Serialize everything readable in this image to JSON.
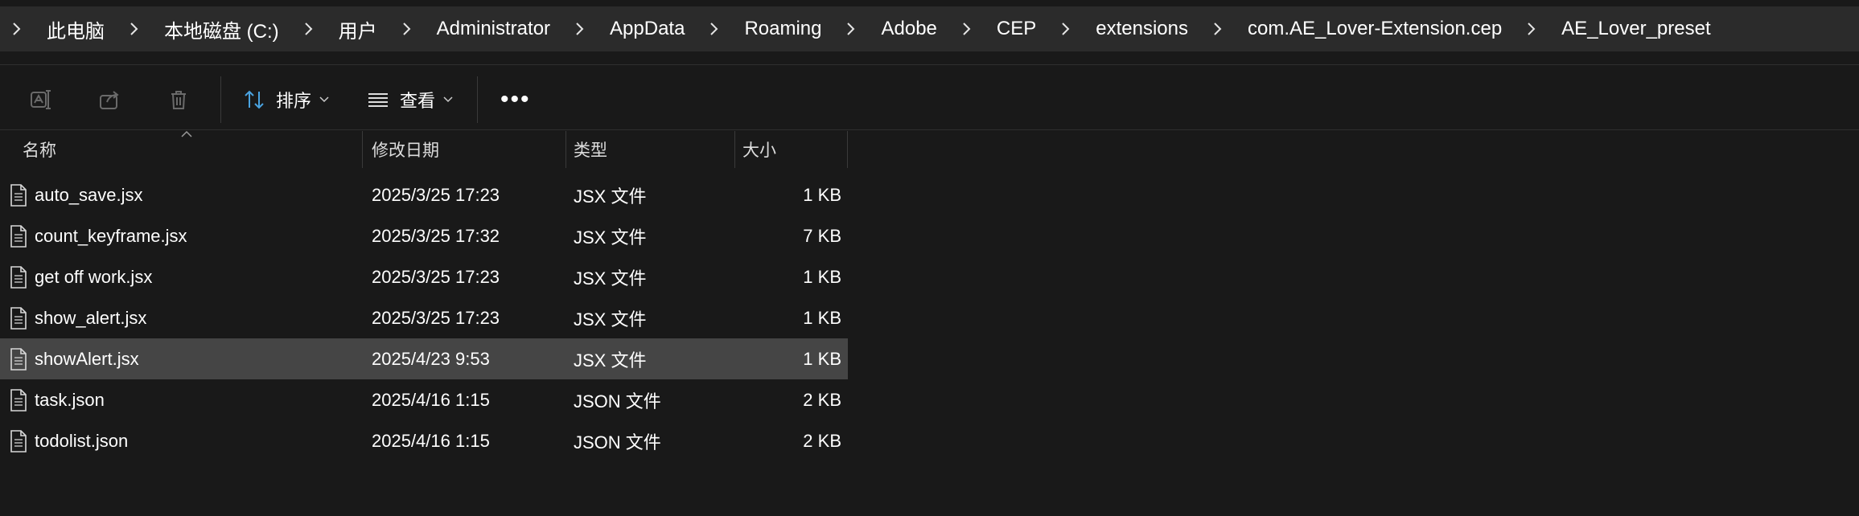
{
  "breadcrumb": [
    "此电脑",
    "本地磁盘 (C:)",
    "用户",
    "Administrator",
    "AppData",
    "Roaming",
    "Adobe",
    "CEP",
    "extensions",
    "com.AE_Lover-Extension.cep",
    "AE_Lover_preset"
  ],
  "toolbar": {
    "rename_icon": "rename-icon",
    "share_icon": "share-icon",
    "delete_icon": "trash-icon",
    "sort_label": "排序",
    "view_label": "查看",
    "more_label": "•••"
  },
  "columns": {
    "name": "名称",
    "date": "修改日期",
    "type": "类型",
    "size": "大小"
  },
  "files": [
    {
      "name": "auto_save.jsx",
      "date": "2025/3/25 17:23",
      "type": "JSX 文件",
      "size": "1 KB"
    },
    {
      "name": "count_keyframe.jsx",
      "date": "2025/3/25 17:32",
      "type": "JSX 文件",
      "size": "7 KB"
    },
    {
      "name": "get off work.jsx",
      "date": "2025/3/25 17:23",
      "type": "JSX 文件",
      "size": "1 KB"
    },
    {
      "name": "show_alert.jsx",
      "date": "2025/3/25 17:23",
      "type": "JSX 文件",
      "size": "1 KB"
    },
    {
      "name": "showAlert.jsx",
      "date": "2025/4/23 9:53",
      "type": "JSX 文件",
      "size": "1 KB"
    },
    {
      "name": "task.json",
      "date": "2025/4/16 1:15",
      "type": "JSON 文件",
      "size": "2 KB"
    },
    {
      "name": "todolist.json",
      "date": "2025/4/16 1:15",
      "type": "JSON 文件",
      "size": "2 KB"
    }
  ],
  "selected_file": "showAlert.jsx",
  "colors": {
    "background": "#191919",
    "breadcrumb_bar": "#2b2b2b",
    "selected_row": "#454545",
    "accent_blue": "#4aa3e0"
  }
}
